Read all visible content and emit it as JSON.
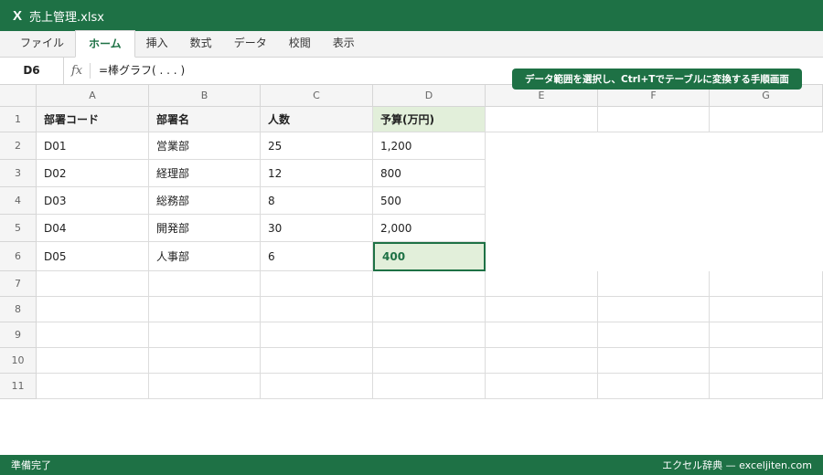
{
  "app": {
    "icon_glyph": "X",
    "title": "売上管理.xlsx"
  },
  "ribbon": {
    "tabs": [
      {
        "label": "ファイル",
        "active": false
      },
      {
        "label": "ホーム",
        "active": true
      },
      {
        "label": "挿入",
        "active": false
      },
      {
        "label": "数式",
        "active": false
      },
      {
        "label": "データ",
        "active": false
      },
      {
        "label": "校閲",
        "active": false
      },
      {
        "label": "表示",
        "active": false
      }
    ]
  },
  "formula_bar": {
    "name_box": "D6",
    "fx_label": "fx",
    "formula": "=棒グラフ( . . . )"
  },
  "caption": "データ範囲を選択し、Ctrl+Tでテーブルに変換する手順画面",
  "sheet": {
    "columns": [
      "A",
      "B",
      "C",
      "D",
      "E",
      "F",
      "G"
    ],
    "rows": [
      "1",
      "2",
      "3",
      "4",
      "5",
      "6",
      "7",
      "8",
      "9",
      "10",
      "11"
    ],
    "header": [
      "部署コード",
      "部署名",
      "人数",
      "予算(万円)"
    ],
    "data": [
      [
        "D01",
        "営業部",
        "25",
        "1,200"
      ],
      [
        "D02",
        "経理部",
        "12",
        "800"
      ],
      [
        "D03",
        "総務部",
        "8",
        "500"
      ],
      [
        "D04",
        "開発部",
        "30",
        "2,000"
      ],
      [
        "D05",
        "人事部",
        "6",
        "400"
      ]
    ],
    "selected_cell": "D6"
  },
  "status": {
    "left": "準備完了",
    "right": "エクセル辞典 — exceljiten.com"
  },
  "colors": {
    "accent": "#1e7145",
    "highlight": "#e2efda"
  }
}
